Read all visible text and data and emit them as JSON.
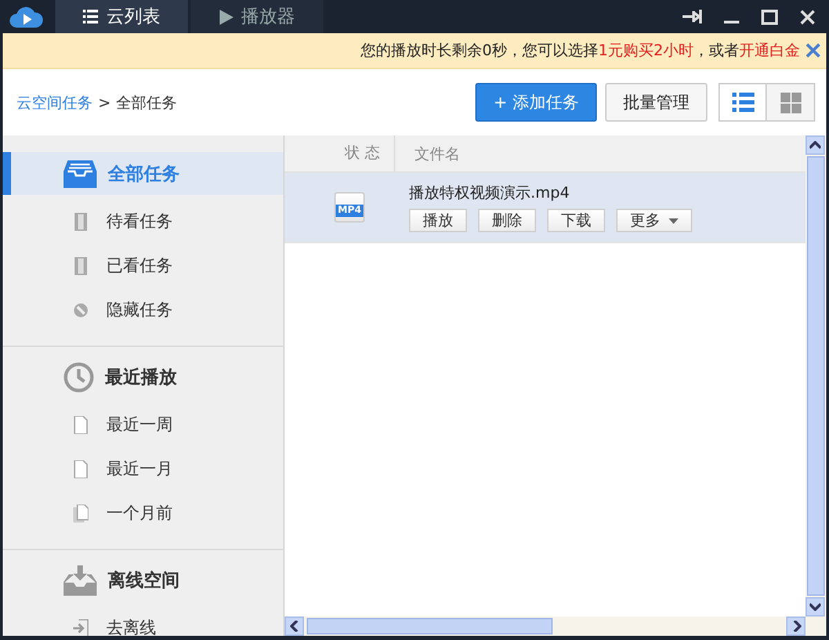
{
  "title_tabs": [
    {
      "label": "云列表",
      "selected": true
    },
    {
      "label": "播放器",
      "selected": false
    }
  ],
  "notice": [
    {
      "text": "您的播放时长剩余0秒，您可以选择",
      "kind": "plain"
    },
    {
      "text": "1元购买2小时",
      "kind": "link"
    },
    {
      "text": "，或者",
      "kind": "plain"
    },
    {
      "text": "开通白金",
      "kind": "link"
    }
  ],
  "breadcrumb": {
    "link": "云空间任务",
    "separator": ">",
    "current": "全部任务"
  },
  "toolbar": {
    "add_button": "+ 添加任务",
    "batch_button": "批量管理",
    "views": [
      {
        "selected": true
      },
      {
        "selected": false
      }
    ]
  },
  "sidebar": [
    {
      "label": "全部任务",
      "selected": true,
      "children": [
        {
          "label": "待看任务"
        },
        {
          "label": "已看任务"
        },
        {
          "label": "隐藏任务"
        }
      ]
    },
    {
      "label": "最近播放",
      "selected": false,
      "children": [
        {
          "label": "最近一周"
        },
        {
          "label": "最近一月"
        },
        {
          "label": "一个月前"
        }
      ]
    },
    {
      "label": "离线空间",
      "selected": false,
      "children": [
        {
          "label": "去离线"
        }
      ]
    }
  ],
  "table": {
    "columns": [
      "状 态",
      "文件名"
    ],
    "rows": [
      {
        "badge": "MP4",
        "name": "播放特权视频演示.mp4",
        "selected": true,
        "actions": [
          {
            "label": "播放",
            "kind": "button"
          },
          {
            "label": "删除",
            "kind": "button"
          },
          {
            "label": "下载",
            "kind": "button"
          },
          {
            "label": "更多",
            "kind": "dropdown"
          }
        ]
      }
    ]
  }
}
